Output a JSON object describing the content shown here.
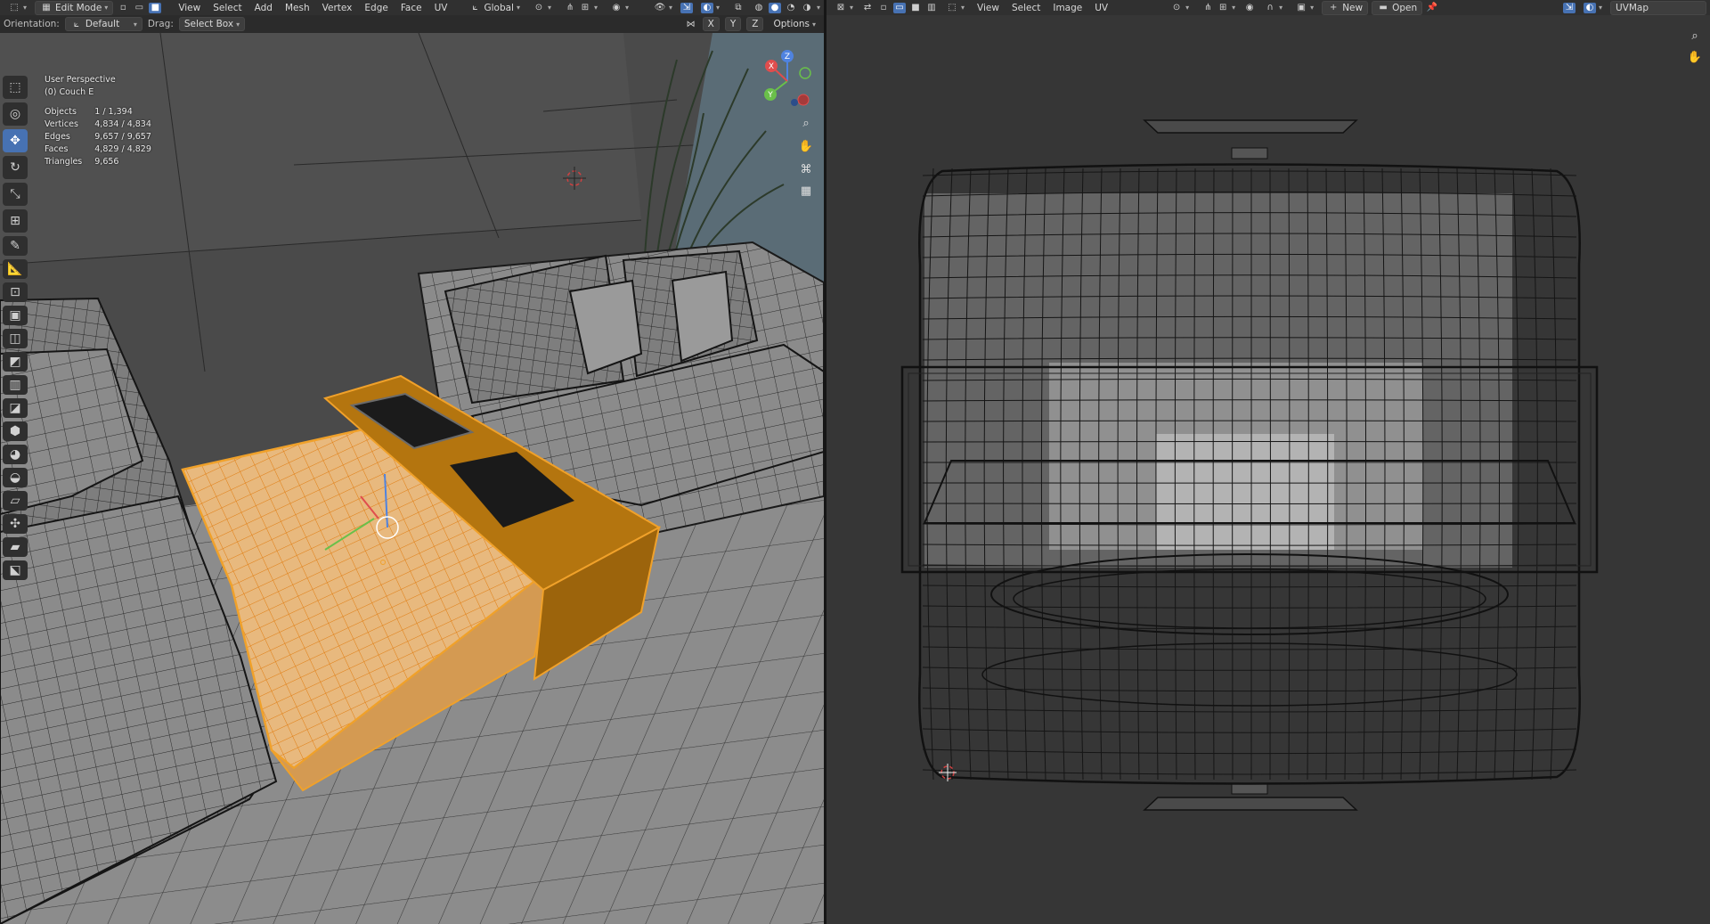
{
  "left_header": {
    "mode": "Edit Mode",
    "menus": [
      "View",
      "Select",
      "Add",
      "Mesh",
      "Vertex",
      "Edge",
      "Face",
      "UV"
    ],
    "transform_orientation": "Global"
  },
  "left_subheader": {
    "orientation_label": "Orientation:",
    "orientation_value": "Default",
    "drag_label": "Drag:",
    "drag_value": "Select Box",
    "axes": [
      "X",
      "Y",
      "Z"
    ],
    "options_label": "Options"
  },
  "viewport_info": {
    "perspective": "User Perspective",
    "object_name": "(0) Couch E",
    "stats": [
      {
        "label": "Objects",
        "value": "1 / 1,394"
      },
      {
        "label": "Vertices",
        "value": "4,834 / 4,834"
      },
      {
        "label": "Edges",
        "value": "9,657 / 9,657"
      },
      {
        "label": "Faces",
        "value": "4,829 / 4,829"
      },
      {
        "label": "Triangles",
        "value": "9,656"
      }
    ]
  },
  "toolbar": [
    {
      "name": "select-box-tool",
      "icon": "cursor-icon",
      "glyph": "⬚"
    },
    {
      "name": "cursor-tool",
      "icon": "crosshair-icon",
      "glyph": "◎"
    },
    {
      "name": "move-tool",
      "icon": "move-icon",
      "glyph": "✥",
      "active": true
    },
    {
      "name": "rotate-tool",
      "icon": "rotate-icon",
      "glyph": "↻"
    },
    {
      "name": "scale-tool",
      "icon": "scale-icon",
      "glyph": "⤡"
    },
    {
      "name": "transform-tool",
      "icon": "transform-icon",
      "glyph": "⊞"
    },
    {
      "name": "annotate-tool",
      "icon": "pencil-icon",
      "glyph": "✎"
    },
    {
      "name": "measure-tool",
      "icon": "ruler-icon",
      "glyph": "📐"
    },
    {
      "name": "add-cube-tool",
      "icon": "cube-add-icon",
      "glyph": "⊡"
    },
    {
      "name": "extrude-tool",
      "icon": "extrude-icon",
      "glyph": "▣"
    },
    {
      "name": "inset-tool",
      "icon": "inset-icon",
      "glyph": "◫"
    },
    {
      "name": "bevel-tool",
      "icon": "bevel-icon",
      "glyph": "◩"
    },
    {
      "name": "loop-cut-tool",
      "icon": "loopcut-icon",
      "glyph": "▥"
    },
    {
      "name": "knife-tool",
      "icon": "knife-icon",
      "glyph": "◪"
    },
    {
      "name": "poly-build-tool",
      "icon": "polybuild-icon",
      "glyph": "⬢"
    },
    {
      "name": "spin-tool",
      "icon": "spin-icon",
      "glyph": "◕"
    },
    {
      "name": "smooth-tool",
      "icon": "smooth-icon",
      "glyph": "◒"
    },
    {
      "name": "edge-slide-tool",
      "icon": "edgeslide-icon",
      "glyph": "▱"
    },
    {
      "name": "shrink-fatten-tool",
      "icon": "shrink-icon",
      "glyph": "✣"
    },
    {
      "name": "shear-tool",
      "icon": "shear-icon",
      "glyph": "▰"
    },
    {
      "name": "rip-region-tool",
      "icon": "rip-icon",
      "glyph": "⬕"
    }
  ],
  "right_header": {
    "menus": [
      "View",
      "Select",
      "Image",
      "UV"
    ],
    "new_label": "New",
    "open_label": "Open",
    "uvmap_value": "UVMap"
  },
  "gizmo_axes": [
    "X",
    "Y",
    "Z"
  ],
  "colors": {
    "selection_orange": "#f0a12a",
    "active_blue": "#4772b3",
    "wire": "#111111",
    "uv_bg": "#363636"
  }
}
